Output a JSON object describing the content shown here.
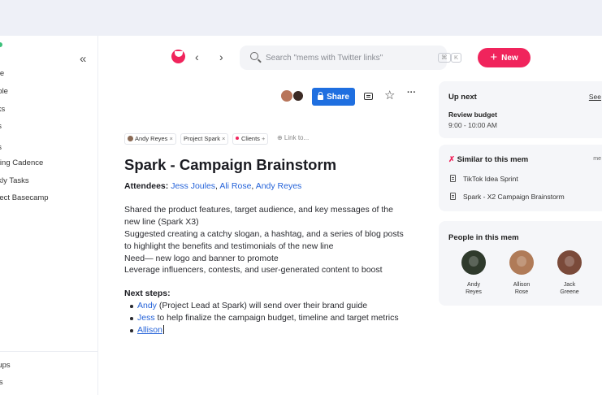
{
  "sidebar": {
    "collapse_glyph": "«",
    "items": [
      "me",
      "ople",
      "sks",
      "gs",
      "es",
      "eting Cadence",
      "ekly Tasks",
      "oject Basecamp"
    ],
    "bottom_items": [
      "oups",
      "ws"
    ]
  },
  "header": {
    "back_glyph": "‹",
    "forward_glyph": "›",
    "search_placeholder": "Search \"mems with Twitter links\"",
    "shortcut_keys": [
      "⌘",
      "K"
    ],
    "new_label": "New",
    "new_plus": "+"
  },
  "toolbar": {
    "share_label": "Share",
    "star_glyph": "☆",
    "more_glyph": "···"
  },
  "tags": {
    "items": [
      {
        "label": "Andy Reyes",
        "remove": "×"
      },
      {
        "label": "Project Spark",
        "remove": "×"
      },
      {
        "label": "Clients",
        "remove": "+"
      }
    ],
    "link_to": "⊕ Link to..."
  },
  "doc": {
    "title": "Spark - Campaign Brainstorm",
    "attendees_label": "Attendees:",
    "attendees": [
      "Jess Joules",
      "Ali Rose",
      "Andy Reyes"
    ],
    "sep": ", ",
    "paragraphs": [
      "Shared the product features, target audience, and key messages of the",
      "new line (Spark X3)",
      "Suggested creating a catchy slogan, a hashtag, and a series of blog posts",
      "to highlight the benefits and testimonials of the new line",
      "Need— new logo and banner to promote",
      "Leverage influencers, contests, and user-generated content to boost"
    ],
    "next_steps_label": "Next steps:",
    "next_steps": [
      {
        "person": "Andy",
        "text": " (Project Lead at Spark) will send over their brand guide"
      },
      {
        "person": "Jess",
        "text": " to help finalize the campaign budget, timeline and target metrics"
      },
      {
        "person": "Allison",
        "text": ""
      }
    ]
  },
  "right": {
    "up_next": {
      "title": "Up next",
      "see": "See",
      "event_title": "Review budget",
      "event_time": "9:00 - 10:00 AM"
    },
    "similar": {
      "icon": "✗",
      "title": "Similar to this mem",
      "right": "me",
      "items": [
        "TikTok Idea Sprint",
        "Spark - X2 Campaign Brainstorm"
      ]
    },
    "people": {
      "title": "People in this mem",
      "items": [
        {
          "first": "Andy",
          "last": "Reyes",
          "color": "#2f3a2c"
        },
        {
          "first": "Allison",
          "last": "Rose",
          "color": "#b07b58"
        },
        {
          "first": "Jack",
          "last": "Greene",
          "color": "#7a4a3a"
        }
      ]
    }
  },
  "colors": {
    "accent": "#f0245c",
    "share": "#1f6fe0",
    "link": "#2563d9"
  }
}
